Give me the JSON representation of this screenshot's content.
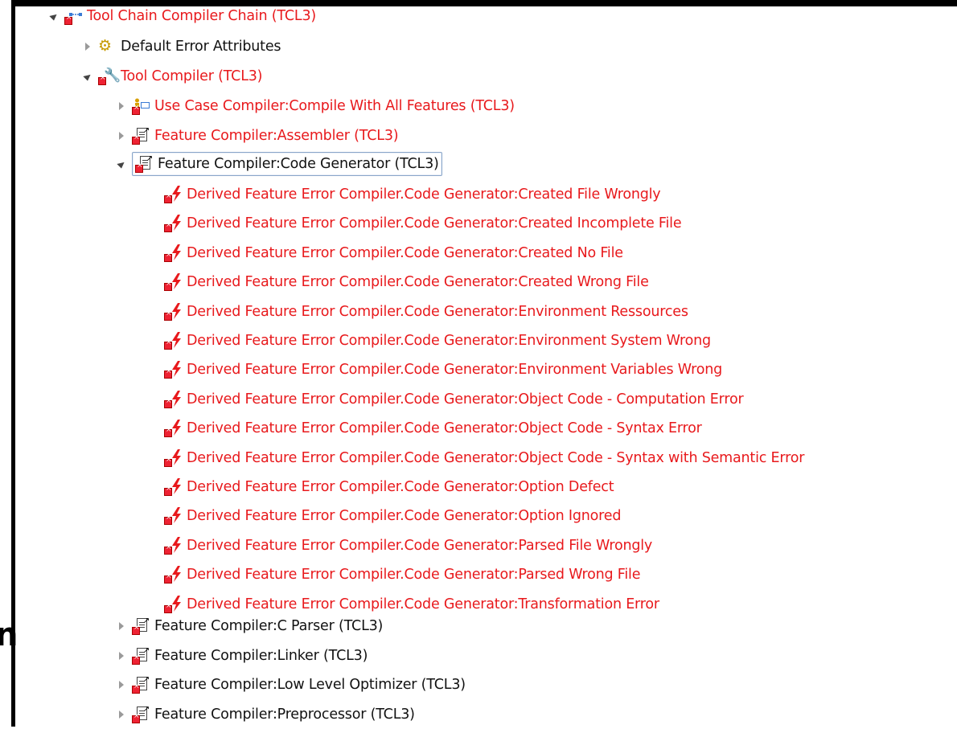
{
  "tree": {
    "root": {
      "label": "Tool Chain Compiler Chain (TCL3)",
      "expanded": true,
      "icon": "tool-chain-icon"
    },
    "default_error_attributes": {
      "label": "Default Error Attributes",
      "expanded": false,
      "icon": "gears-icon"
    },
    "tool_compiler": {
      "label": "Tool Compiler (TCL3)",
      "expanded": true,
      "icon": "tool-icon"
    },
    "children": [
      {
        "label": "Use Case Compiler:Compile With All Features (TCL3)",
        "expanded": false,
        "icon": "use-case-icon",
        "color": "red"
      },
      {
        "label": "Feature Compiler:Assembler (TCL3)",
        "expanded": false,
        "icon": "feature-icon",
        "color": "red"
      },
      {
        "label": "Feature Compiler:Code Generator (TCL3)",
        "expanded": true,
        "icon": "feature-icon",
        "color": "black",
        "selected": true
      }
    ],
    "derived_errors": [
      "Derived Feature Error Compiler.Code Generator:Created File Wrongly",
      "Derived Feature Error Compiler.Code Generator:Created Incomplete File",
      "Derived Feature Error Compiler.Code Generator:Created No File",
      "Derived Feature Error Compiler.Code Generator:Created Wrong File",
      "Derived Feature Error Compiler.Code Generator:Environment Ressources",
      "Derived Feature Error Compiler.Code Generator:Environment System Wrong",
      "Derived Feature Error Compiler.Code Generator:Environment Variables Wrong",
      "Derived Feature Error Compiler.Code Generator:Object Code - Computation Error",
      "Derived Feature Error Compiler.Code Generator:Object Code - Syntax Error",
      "Derived Feature Error Compiler.Code Generator:Object Code - Syntax with Semantic Error",
      "Derived Feature Error Compiler.Code Generator:Option Defect",
      "Derived Feature Error Compiler.Code Generator:Option Ignored",
      "Derived Feature Error Compiler.Code Generator:Parsed File Wrongly",
      "Derived Feature Error Compiler.Code Generator:Parsed Wrong File",
      "Derived Feature Error Compiler.Code Generator:Transformation Error"
    ],
    "trailing_features": [
      "Feature Compiler:C Parser (TCL3)",
      "Feature Compiler:Linker (TCL3)",
      "Feature Compiler:Low Level Optimizer (TCL3)",
      "Feature Compiler:Preprocessor (TCL3)"
    ]
  },
  "stray_glyph": "n",
  "colors": {
    "error_text": "#e8191c",
    "normal_text": "#111111",
    "selection_border": "#8aa6c9"
  }
}
